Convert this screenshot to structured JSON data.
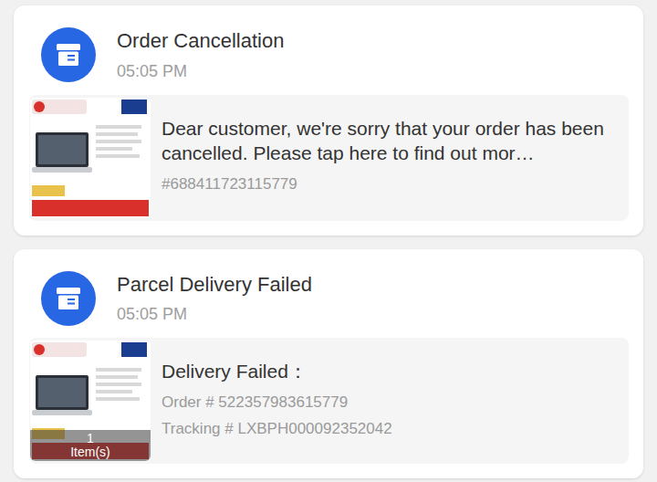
{
  "notifications": [
    {
      "kind": "message",
      "title": "Order Cancellation",
      "time": "05:05 PM",
      "message": "Dear customer, we're sorry that your order has been cancelled. Please tap here to find out mor…",
      "details": [
        "#688411723115779"
      ]
    },
    {
      "kind": "delivery",
      "title": "Parcel Delivery Failed",
      "time": "05:05 PM",
      "message": "Delivery Failed：",
      "details": [
        "Order # 522357983615779",
        "Tracking # LXBPH000092352042"
      ],
      "item_count": "1",
      "item_label": "Item(s)"
    }
  ]
}
